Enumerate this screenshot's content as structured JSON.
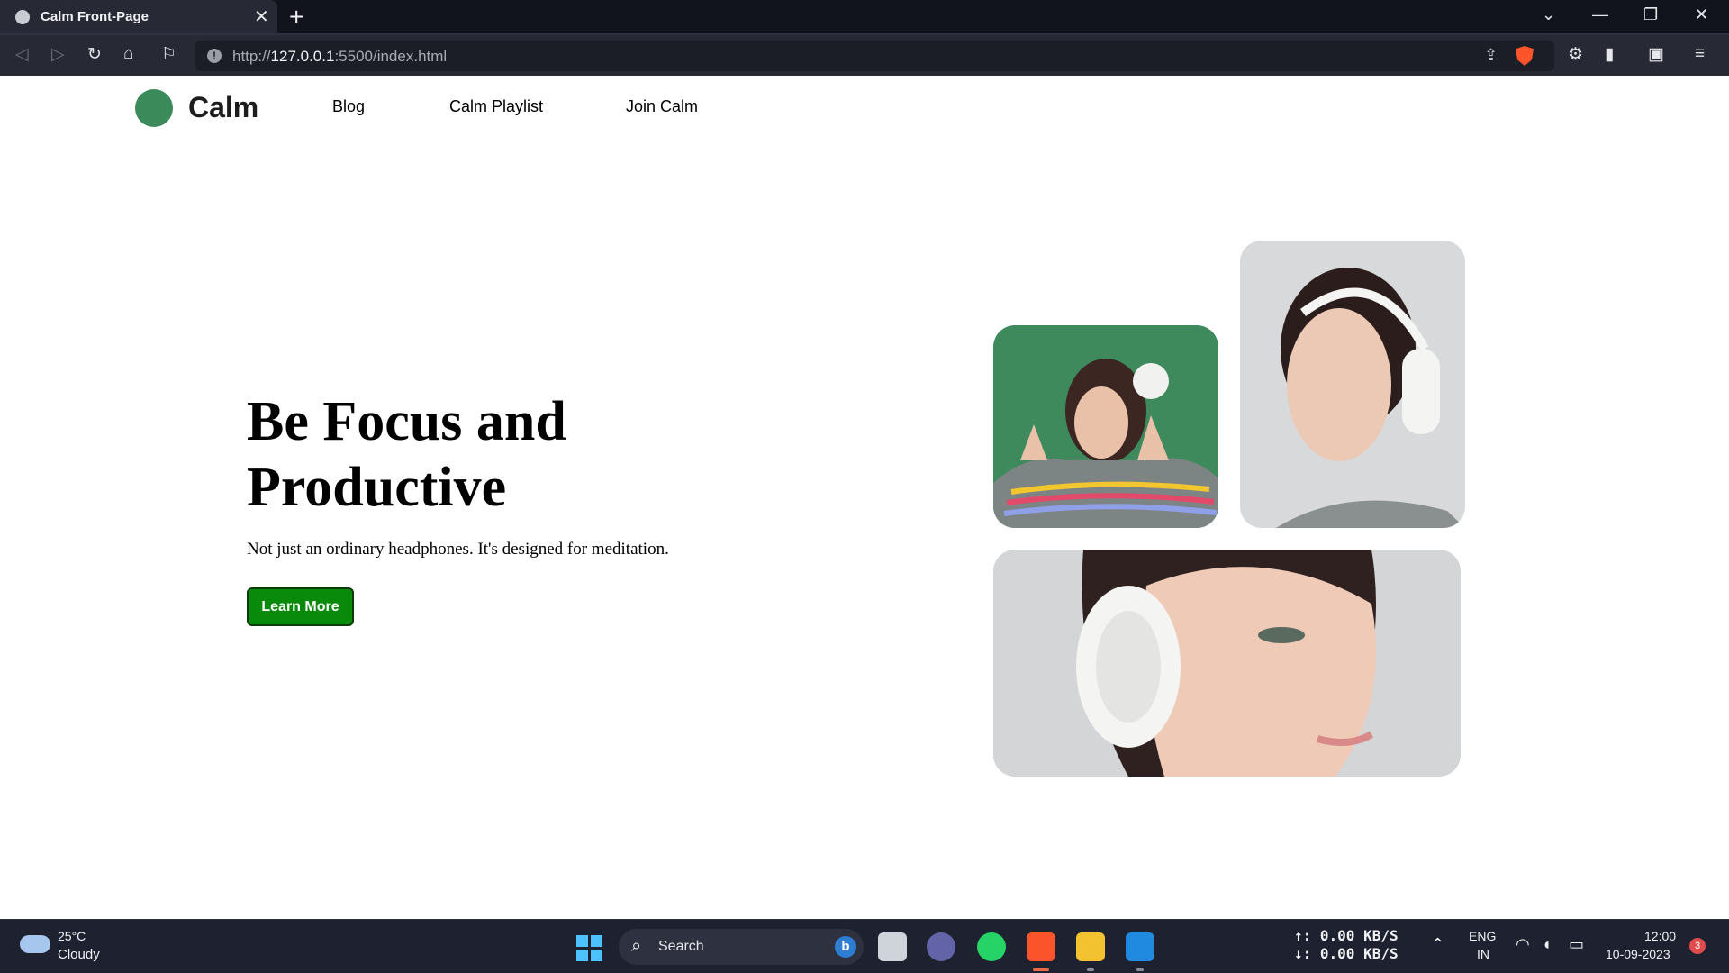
{
  "browser": {
    "tab_title": "Calm Front-Page",
    "tab_close": "✕",
    "new_tab": "+",
    "url_prefix": "http://",
    "url_host": "127.0.0.1",
    "url_rest": ":5500/index.html",
    "window_controls": [
      "⌄",
      "—",
      "❐",
      "✕"
    ]
  },
  "site": {
    "logo_text": "Calm",
    "nav": [
      "Blog",
      "Calm Playlist",
      "Join Calm"
    ]
  },
  "hero": {
    "title_line1": "Be Focus and",
    "title_line2": "Productive",
    "subtitle": "Not just an ordinary headphones. It's designed for meditation.",
    "button_label": "Learn More"
  },
  "taskbar": {
    "weather_temp": "25°C",
    "weather_condition": "Cloudy",
    "search_placeholder": "Search",
    "net_up": "↑: 0.00 KB/S",
    "net_down": "↓: 0.00 KB/S",
    "lang_line1": "ENG",
    "lang_line2": "IN",
    "time": "12:00",
    "date": "10-09-2023",
    "notification_count": "3"
  },
  "colors": {
    "accent_green": "#3a8a5a",
    "button_green": "#0a8a0a"
  }
}
